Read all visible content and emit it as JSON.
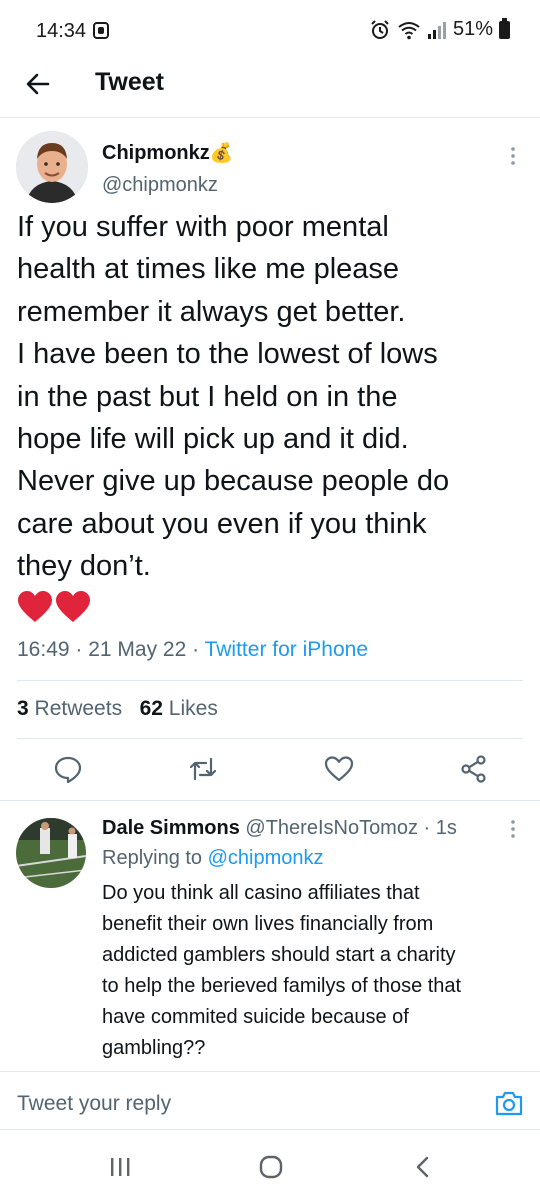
{
  "status_bar": {
    "time": "14:34",
    "battery": "51%",
    "icons": [
      "notification-icon",
      "alarm-icon",
      "wifi-icon",
      "signal-icon",
      "battery-icon"
    ]
  },
  "app_bar": {
    "title": "Tweet",
    "back_icon": "back-arrow-icon"
  },
  "tweet": {
    "author_name": "Chipmonkz",
    "author_badge": "💰",
    "author_handle": "@chipmonkz",
    "text_lines": [
      "If you suffer with poor mental",
      "health at times like me please",
      "remember it always get better.",
      "I have been to the lowest of lows",
      "in the past but I held on in the",
      "hope life will pick up and it did.",
      "Never give up because people do",
      "care about you even if you think",
      "they don’t."
    ],
    "emoji": "❤️❤️",
    "time": "16:49",
    "date": "21 May 22",
    "source": "Twitter for iPhone",
    "retweets_count": "3",
    "retweets_label": "Retweets",
    "likes_count": "62",
    "likes_label": "Likes",
    "actions": [
      "reply-icon",
      "retweet-icon",
      "like-icon",
      "share-icon"
    ]
  },
  "reply": {
    "author_name": "Dale Simmons",
    "author_handle": "@ThereIsNoTomoz",
    "age": "1s",
    "replying_prefix": "Replying to",
    "replying_handle": "@chipmonkz",
    "text_lines": [
      "Do you think all casino affiliates that",
      "benefit their own lives financially from",
      "addicted gamblers should start a charity",
      "to help the berieved familys of those that",
      "have commited suicide because of",
      "gambling??"
    ]
  },
  "composer": {
    "placeholder": "Tweet your reply",
    "camera_icon": "camera-icon"
  },
  "nav_bar": {
    "icons": [
      "recents-icon",
      "home-icon",
      "back-icon"
    ]
  },
  "colors": {
    "accent": "#1d9bf0",
    "secondary_text": "#536471",
    "divider": "#e1e8ed",
    "heart": "#e0243b"
  }
}
